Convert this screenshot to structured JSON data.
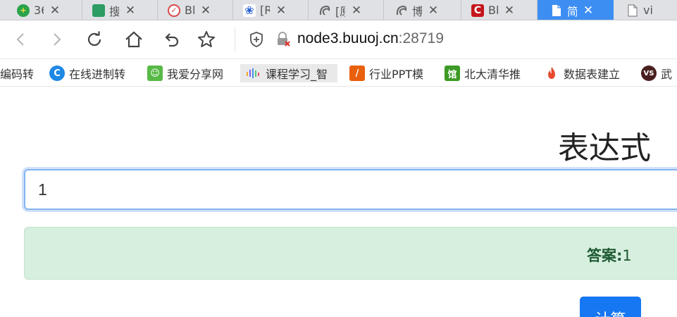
{
  "tabs": [
    {
      "title": "36",
      "icon": "plus-circle-icon",
      "color": "#2aa34a",
      "active": false
    },
    {
      "title": "搜",
      "icon": "book-icon",
      "color": "#2e9c63",
      "active": false
    },
    {
      "title": "Bl",
      "icon": "seal-icon",
      "color": "#d94a4a",
      "active": false
    },
    {
      "title": "[R",
      "icon": "paw-icon",
      "color": "#2f66d6",
      "active": false
    },
    {
      "title": "[原",
      "icon": "swirl-icon",
      "color": "#666666",
      "active": false
    },
    {
      "title": "博",
      "icon": "swirl-icon",
      "color": "#666666",
      "active": false
    },
    {
      "title": "Bl",
      "icon": "c-logo-icon",
      "color": "#c4161c",
      "active": false
    },
    {
      "title": "简",
      "icon": "page-icon",
      "color": "#ffffff",
      "active": true
    },
    {
      "title": "vi",
      "icon": "page-icon",
      "color": "#888888",
      "active": false
    }
  ],
  "address": {
    "host": "node3.buuoj.cn",
    "port": ":28719"
  },
  "bookmarks": [
    {
      "label": "编码转",
      "icon": "",
      "color": ""
    },
    {
      "label": "在线进制转",
      "icon": "c-circle-icon",
      "color": "#1e88e5"
    },
    {
      "label": "我爱分享网",
      "icon": "frog-icon",
      "color": "#58b947"
    },
    {
      "label": "课程学习_智",
      "icon": "bars-icon",
      "color": "#7b61ff"
    },
    {
      "label": "行业PPT模",
      "icon": "slash-icon",
      "color": "#e8600c"
    },
    {
      "label": "北大清华推",
      "icon": "guan-icon",
      "color": "#3d9a25"
    },
    {
      "label": "数据表建立",
      "icon": "flame-icon",
      "color": "#e6492d"
    },
    {
      "label": "武",
      "icon": "vs-icon",
      "color": "#4a1f1f"
    }
  ],
  "page": {
    "title": "表达式",
    "expression_value": "1",
    "result_label": "答案:",
    "result_value": "1",
    "button_label": "计算"
  },
  "colors": {
    "active_tab": "#3d8ef3",
    "result_bg": "#d7efde",
    "button": "#1677f2",
    "input_focus": "#82b4f0"
  }
}
